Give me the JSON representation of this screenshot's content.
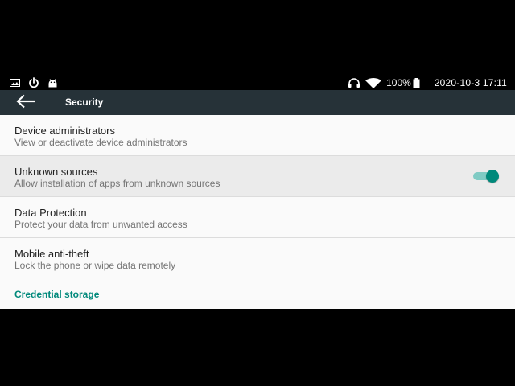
{
  "status_bar": {
    "left_icons": [
      "image-icon",
      "power-icon",
      "android-icon"
    ],
    "right_icons": [
      "headphones-icon",
      "wifi-icon"
    ],
    "battery": "100%",
    "datetime": "2020-10-3 17:11"
  },
  "toolbar": {
    "back_icon": "back-arrow-icon",
    "title": "Security",
    "background": "#263238"
  },
  "preferences": [
    {
      "title": "Device administrators",
      "summary": "View or deactivate device administrators"
    },
    {
      "title": "Unknown sources",
      "summary": "Allow installation of apps from unknown sources",
      "switch_on": true
    },
    {
      "title": "Data Protection",
      "summary": "Protect your data from unwanted access"
    },
    {
      "title": "Mobile anti-theft",
      "summary": "Lock the phone or wipe data remotely"
    }
  ],
  "category": {
    "label": "Credential storage"
  },
  "colors": {
    "accent": "#00897b",
    "switch_track": "#80cbc4"
  }
}
